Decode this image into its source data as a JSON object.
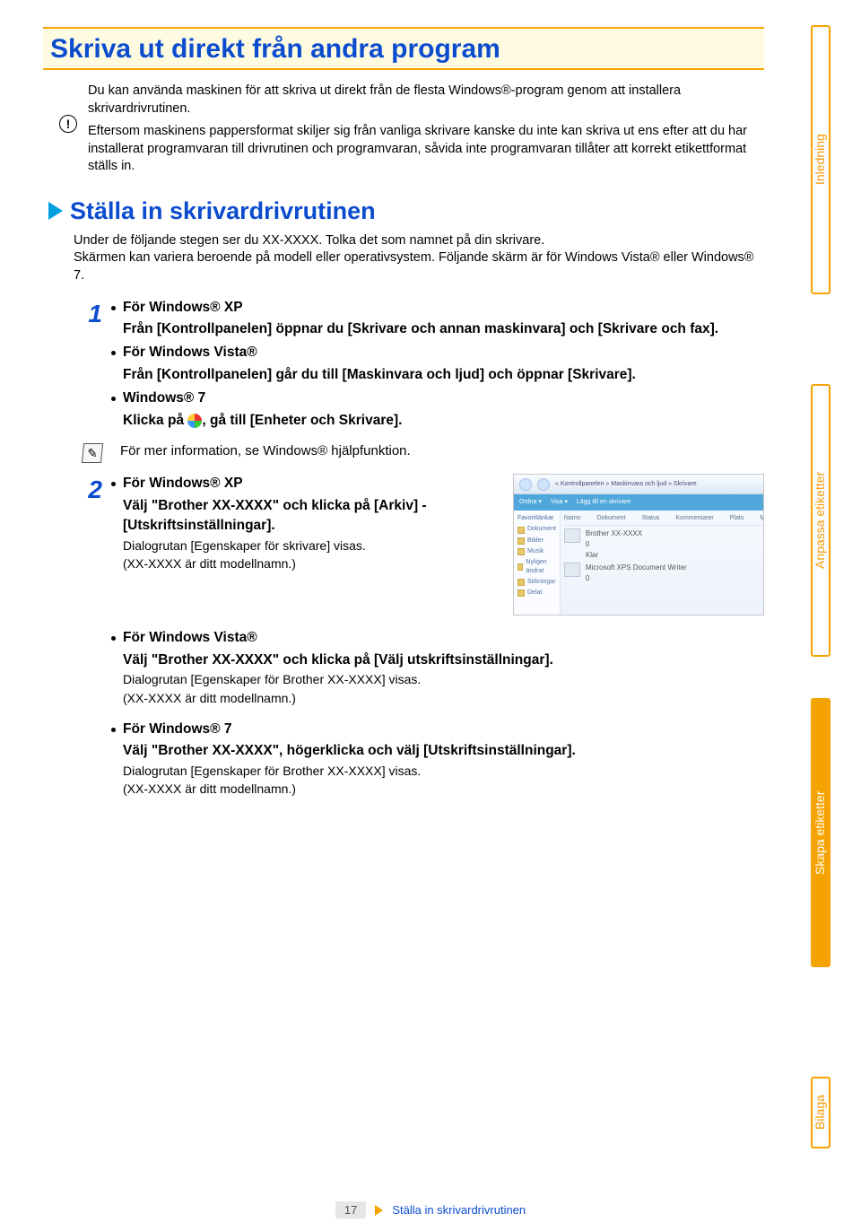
{
  "page": {
    "title": "Skriva ut direkt från andra program",
    "intro1": "Du kan använda maskinen för att skriva ut direkt från de flesta Windows®-program genom att installera skrivardrivrutinen.",
    "intro2": "Eftersom maskinens pappersformat skiljer sig från vanliga skrivare kanske du inte kan skriva ut ens efter att du har installerat programvaran till drivrutinen och programvaran, såvida inte programvaran tillåter att korrekt etikettformat ställs in.",
    "h2": "Ställa in skrivardrivrutinen",
    "sub1": "Under de följande stegen ser du XX-XXXX. Tolka det som namnet på din skrivare.",
    "sub2": "Skärmen kan variera beroende på modell eller operativsystem. Följande skärm är för Windows Vista® eller Windows® 7."
  },
  "step1": {
    "xp_head": "För Windows® XP",
    "xp_body": "Från [Kontrollpanelen] öppnar du [Skrivare och annan maskinvara] och [Skrivare och fax].",
    "vista_head": "För Windows Vista®",
    "vista_body": "Från [Kontrollpanelen] går du till [Maskinvara och ljud] och öppnar [Skrivare].",
    "w7_head": "Windows® 7",
    "w7_body_a": "Klicka på ",
    "w7_body_b": ", gå till [Enheter och Skrivare].",
    "note": "För mer information, se Windows® hjälpfunktion."
  },
  "step2": {
    "xp_head": "För Windows® XP",
    "xp_l1": "Välj \"Brother XX-XXXX\" och klicka på [Arkiv] - [Utskriftsinställningar].",
    "xp_s1": "Dialogrutan [Egenskaper för skrivare] visas.",
    "xp_s2": "(XX-XXXX är ditt modellnamn.)",
    "vista_head": "För Windows Vista®",
    "vista_l1": "Välj \"Brother XX-XXXX\" och klicka på [Välj utskriftsinställningar].",
    "vista_s1": "Dialogrutan [Egenskaper för Brother XX-XXXX] visas.",
    "vista_s2": "(XX-XXXX är ditt modellnamn.)",
    "w7_head": "För Windows® 7",
    "w7_l1": "Välj \"Brother XX-XXXX\", högerklicka och välj [Utskriftsinställningar].",
    "w7_s1": "Dialogrutan [Egenskaper för Brother XX-XXXX] visas.",
    "w7_s2": "(XX-XXXX är ditt modellnamn.)"
  },
  "win": {
    "crumb": "« Kontrollpanelen » Maskinvara och ljud » Skrivare",
    "tool1": "Ordna ▾",
    "tool2": "Visa ▾",
    "tool3": "Lägg till en skrivare",
    "side_head": "Favoritlänkar",
    "side_items": [
      "Dokument",
      "Bilder",
      "Musik",
      "Nyligen ändrat",
      "Sökningar",
      "Delat"
    ],
    "hdr": [
      "Namn",
      "Dokument",
      "Status",
      "Kommentarer",
      "Plats",
      "Modell"
    ],
    "row1a": "Brother XX-XXXX",
    "row1b": "0",
    "row1c": "Klar",
    "row2a": "Microsoft XPS Document Writer",
    "row2b": "0"
  },
  "tabs": {
    "t1": "Inledning",
    "t2": "Anpassa etiketter",
    "t3": "Skapa etiketter",
    "t4": "Bilaga"
  },
  "footer": {
    "num": "17",
    "bc": "Ställa in skrivardrivrutinen"
  }
}
